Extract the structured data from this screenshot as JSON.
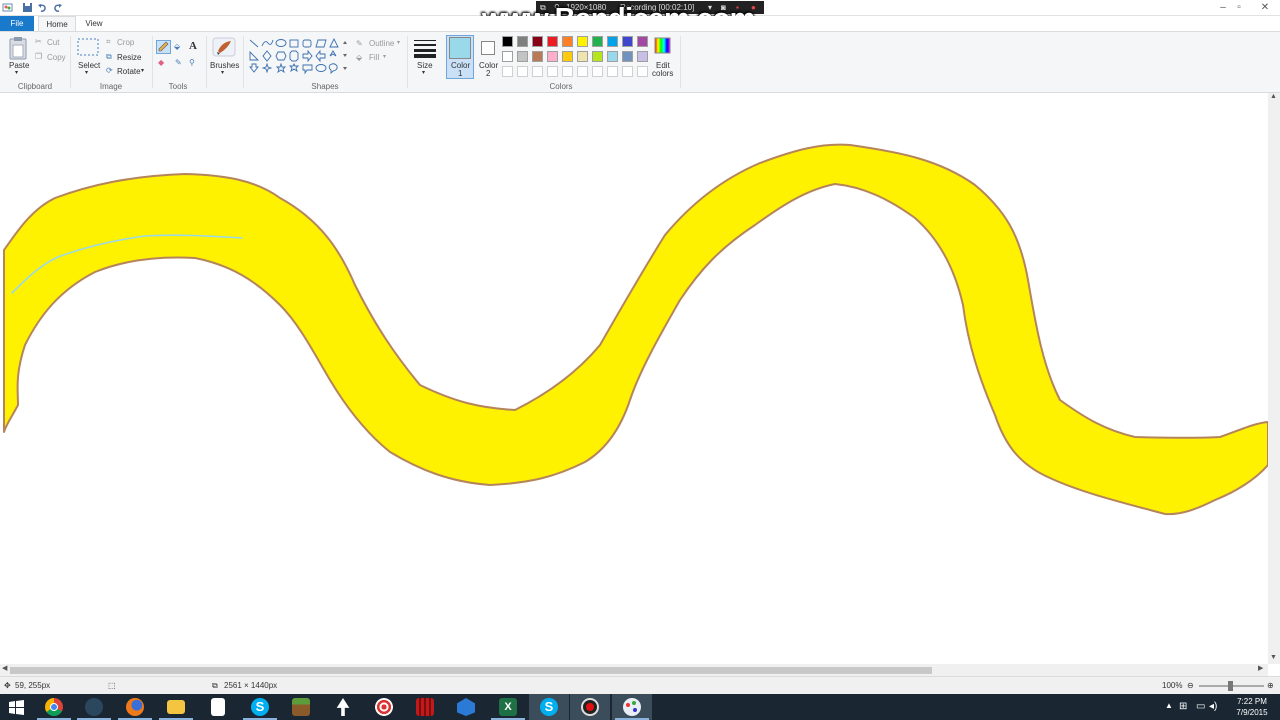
{
  "title_bar": {
    "controls": [
      "minimize-icon",
      "maximize-icon",
      "close-icon"
    ]
  },
  "recorder": {
    "resolution": "1920×1080",
    "status": "Recording [00:02:10]",
    "watermark": "www.Bandicam.com"
  },
  "tabs": [
    {
      "label": "File"
    },
    {
      "label": "Home"
    },
    {
      "label": "View"
    }
  ],
  "ribbon": {
    "clipboard": {
      "paste": "Paste",
      "cut": "Cut",
      "copy": "Copy",
      "group": "Clipboard"
    },
    "image": {
      "select": "Select",
      "crop": "Crop",
      "resize": "Resize",
      "rotate": "Rotate",
      "group": "Image"
    },
    "tools": {
      "group": "Tools"
    },
    "brushes": {
      "label": "Brushes"
    },
    "shapes": {
      "outline": "Outline",
      "fill": "Fill",
      "group": "Shapes"
    },
    "size": {
      "label": "Size"
    },
    "color1": {
      "label": "Color",
      "num": "1",
      "color": "#99d9ea"
    },
    "color2": {
      "label": "Color",
      "num": "2",
      "color": "#ffffff"
    },
    "colors_group": "Colors",
    "edit_colors": {
      "line1": "Edit",
      "line2": "colors"
    },
    "palette_row1": [
      "#000000",
      "#7f7f7f",
      "#880015",
      "#ed1c24",
      "#ff7f27",
      "#fff200",
      "#22b14c",
      "#00a2e8",
      "#3f48cc",
      "#a349a4"
    ],
    "palette_row2": [
      "#ffffff",
      "#c3c3c3",
      "#b97a57",
      "#ffaec9",
      "#ffc90e",
      "#efe4b0",
      "#b5e61d",
      "#99d9ea",
      "#7092be",
      "#c8bfe7"
    ]
  },
  "canvas": {
    "fill_color": "#fff200",
    "outline_color": "#b5845a",
    "stroke_color": "#99d9ea"
  },
  "status_bar": {
    "cursor_pos": "59, 255px",
    "image_size": "2561 × 1440px",
    "zoom": "100%"
  },
  "taskbar": {
    "time": "7:22 PM",
    "date": "7/9/2015",
    "apps": [
      "start-icon",
      "chrome-icon",
      "steam-icon",
      "firefox-icon",
      "file-explorer-icon",
      "document-icon",
      "skype-icon",
      "minecraft-icon",
      "inkscape-icon",
      "target-app-icon",
      "red-app-icon",
      "app-icon",
      "excel-icon",
      "skype-icon",
      "bandicam-icon",
      "paint-icon"
    ]
  }
}
